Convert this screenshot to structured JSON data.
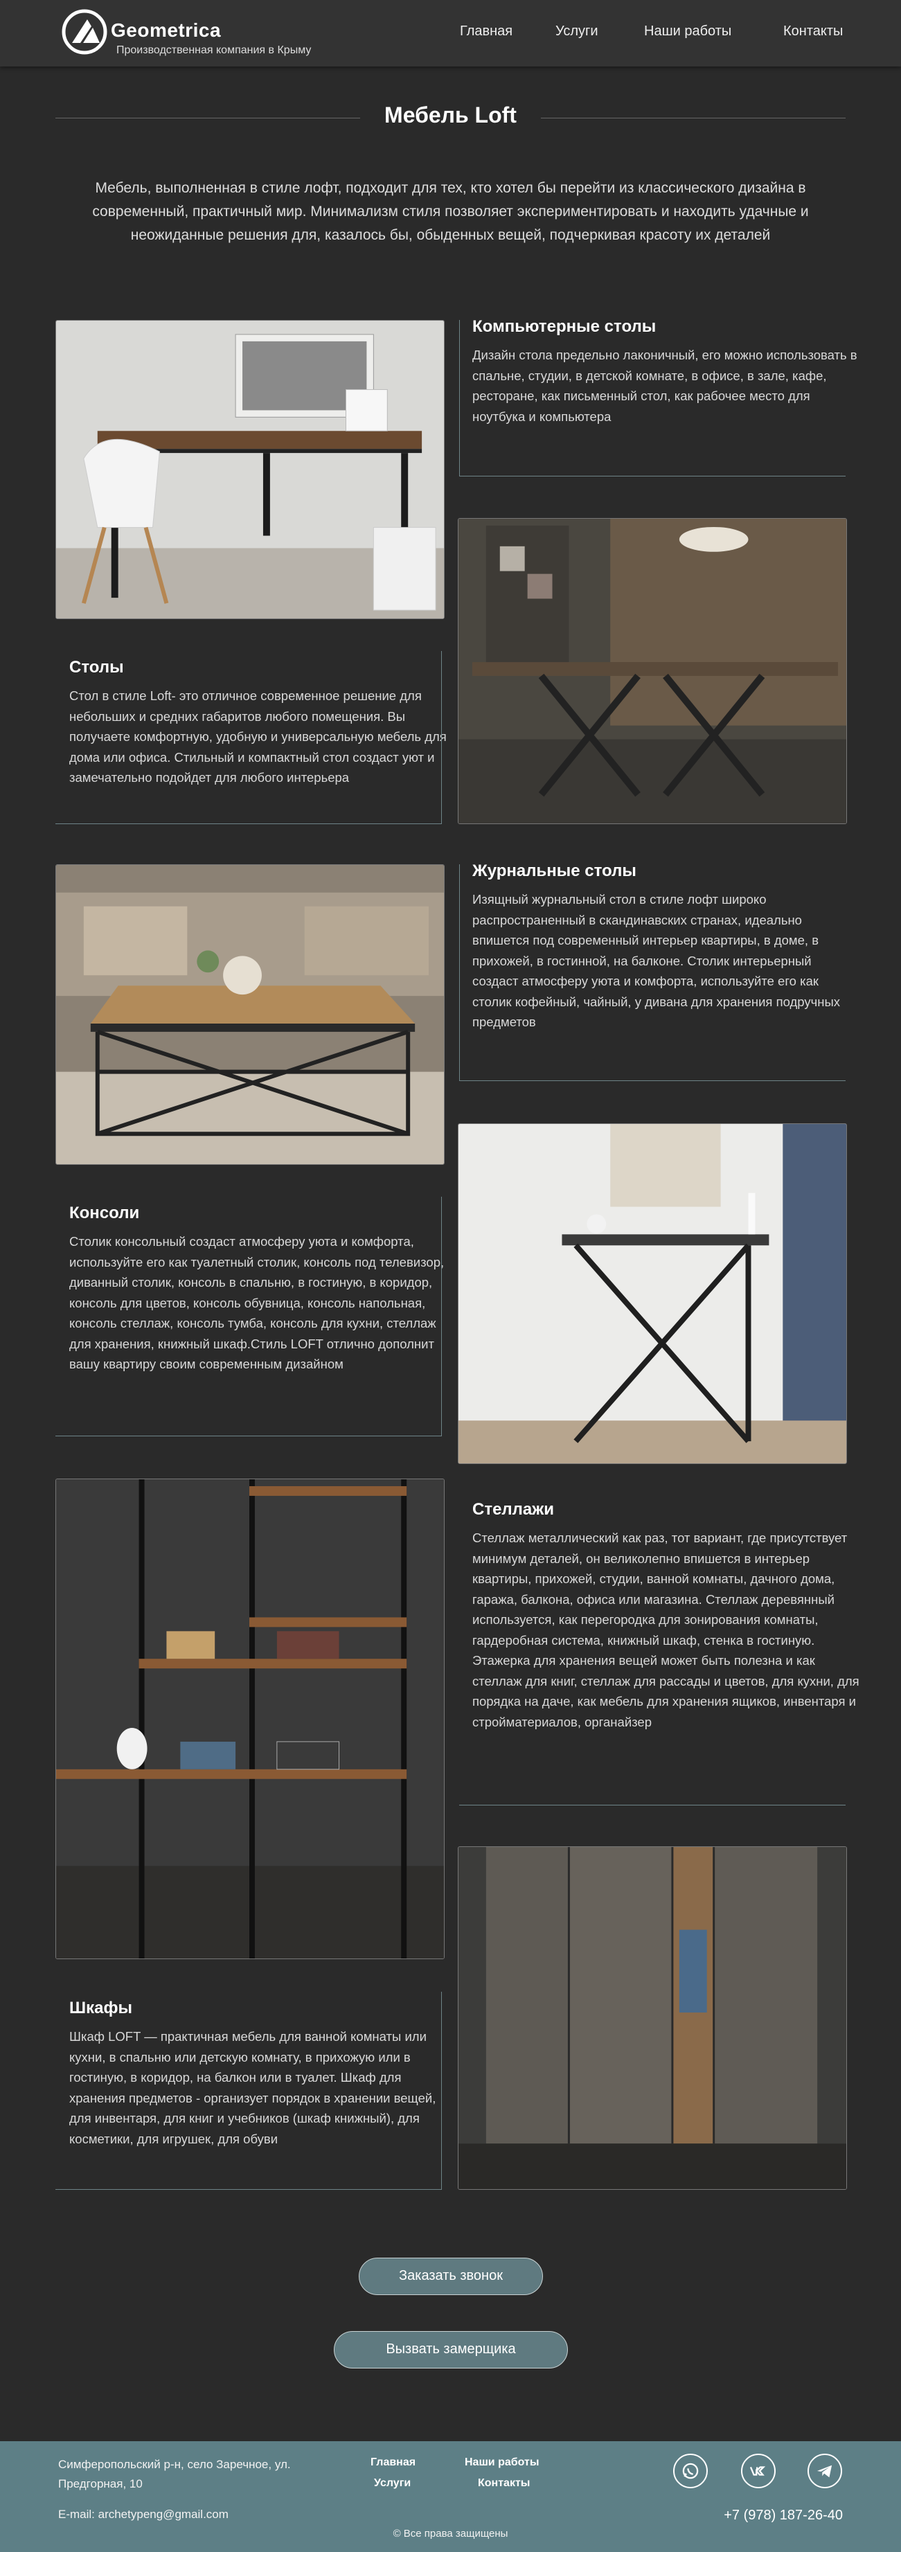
{
  "header": {
    "brand": "Geometrica",
    "tagline": "Производственная компания в Крыму",
    "nav": [
      "Главная",
      "Услуги",
      "Наши работы",
      "Контакты"
    ]
  },
  "main": {
    "title": "Мебель Loft",
    "intro": "Мебель, выполненная в стиле лофт, подходит для тех, кто хотел бы перейти из классического дизайна в современный, практичный мир. Минимализм стиля позволяет экспериментировать и находить удачные и неожиданные решения для, казалось бы, обыденных вещей, подчеркивая красоту их деталей"
  },
  "sections": [
    {
      "title": "Компьютерные столы",
      "text": "Дизайн стола предельно лаконичный, его можно использовать в спальне, студии, в детской комнате, в офисе, в зале, кафе, ресторане, как письменный стол, как рабочее место для ноутбука и компьютера"
    },
    {
      "title": "Столы",
      "text": "Стол в стиле Loft- это отличное современное решение для небольших и средних габаритов любого помещения. Вы получаете комфортную, удобную и универсальную мебель для дома или офиса. Стильный и компактный стол создаст уют и замечательно подойдет для любого интерьера"
    },
    {
      "title": "Журнальные столы",
      "text": "Изящный журнальный стол в стиле лофт широко распространенный в скандинавских странах, идеально впишется под современный интерьер квартиры, в доме, в прихожей, в гостинной, на балконе. Столик интерьерный создаст атмосферу уюта и комфорта, используйте его как столик кофейный, чайный, у дивана для хранения подручных предметов"
    },
    {
      "title": "Консоли",
      "text": "Столик консольный создаст атмосферу уюта и комфорта, используйте его как туалетный столик, консоль под телевизор, диванный столик, консоль в спальню, в гостиную, в коридор, консоль для цветов, консоль обувница, консоль напольная, консоль стеллаж, консоль тумба, консоль для кухни, стеллаж для хранения, книжный шкаф.Стиль LOFT отлично дополнит вашу квартиру своим современным дизайном"
    },
    {
      "title": "Стеллажи",
      "text": "Стеллаж металлический как раз, тот вариант, где присутствует минимум деталей, он великолепно впишется в интерьер квартиры, прихожей, студии, ванной комнаты, дачного дома, гаража, балкона, офиса или магазина. Стеллаж деревянный используется, как перегородка для зонирования комнаты, гардеробная система, книжный шкаф, стенка в гостиную. Этажерка для хранения вещей может быть полезна и как стеллаж для книг, стеллаж для рассады и цветов, для кухни, для порядка на даче, как мебель для хранения ящиков, инвентаря и стройматериалов, органайзер"
    },
    {
      "title": "Шкафы",
      "text": "Шкаф LOFT — практичная мебель для ванной комнаты или кухни, в спальню или детскую комнату, в прихожую или в гостиную, в коридор, на балкон или в туалет. Шкаф для хранения предметов - организует порядок в хранении вещей, для инвентаря, для книг и учебников (шкаф книжный), для косметики, для игрушек, для обуви"
    }
  ],
  "buttons": {
    "order_call": "Заказать звонок",
    "measurer": "Вызвать замерщика"
  },
  "footer": {
    "address": "Симферопольский р-н, село Заречное, ул. Предгорная, 10",
    "links": [
      "Главная",
      "Услуги",
      "Наши работы",
      "Контакты"
    ],
    "email": "E-mail: archetypeng@gmail.com",
    "copyright": "© Все права защищены",
    "phone": "+7 (978) 187-26-40"
  },
  "icons": [
    "logo-icon",
    "whatsapp-icon",
    "vk-icon",
    "telegram-icon"
  ],
  "colors": {
    "background": "#2a2a2a",
    "header": "#333333",
    "accent": "#5f7a80",
    "footer": "#5d7f86"
  }
}
